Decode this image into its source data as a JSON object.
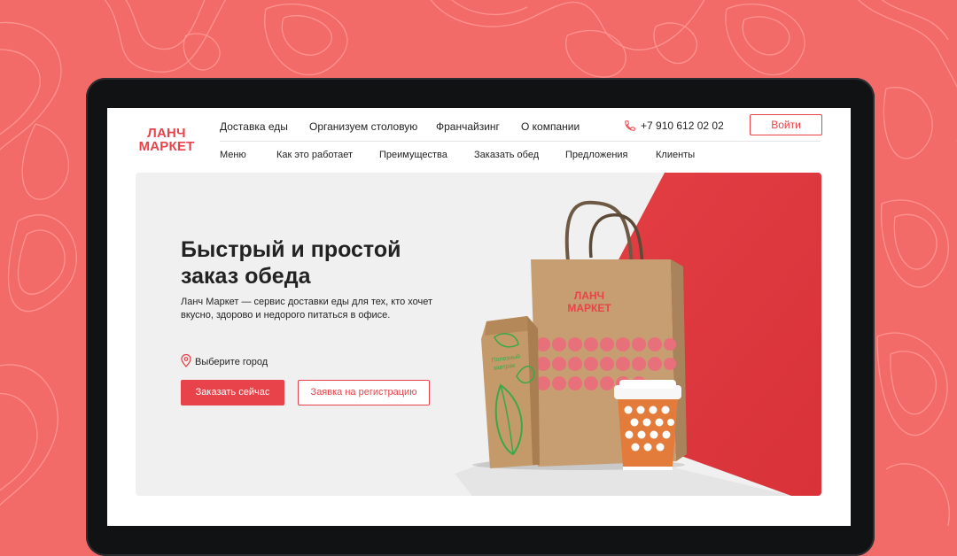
{
  "brand": {
    "logo_line1": "ЛАНЧ",
    "logo_line2": "МАРКЕТ",
    "accent_color": "#e8434a",
    "background_color": "#f36b69"
  },
  "header": {
    "primary_nav": [
      {
        "label": "Доставка еды"
      },
      {
        "label": "Организуем столовую"
      },
      {
        "label": "Франчайзинг"
      },
      {
        "label": "О компании"
      }
    ],
    "phone_icon": "phone-icon",
    "phone": "+7 910 612 02 02",
    "login_label": "Войти",
    "secondary_nav": [
      {
        "label": "Меню"
      },
      {
        "label": "Как это работает"
      },
      {
        "label": "Преимущества"
      },
      {
        "label": "Заказать обед"
      },
      {
        "label": "Предложения"
      },
      {
        "label": "Клиенты"
      }
    ]
  },
  "hero": {
    "title_line1": "Быстрый и простой",
    "title_line2": "заказ обеда",
    "description_line1": "Ланч Маркет — сервис доставки еды для тех, кто хочет",
    "description_line2": "вкусно, здорово и недорого питаться в офисе.",
    "city_icon": "location-pin-icon",
    "city_label": "Выберите город",
    "order_button": "Заказать сейчас",
    "register_button": "Заявка на регистрацию",
    "bag_logo_line1": "ЛАНЧ",
    "bag_logo_line2": "МАРКЕТ",
    "pouch_text_line1": "Полезный",
    "pouch_text_line2": "завтрак"
  }
}
